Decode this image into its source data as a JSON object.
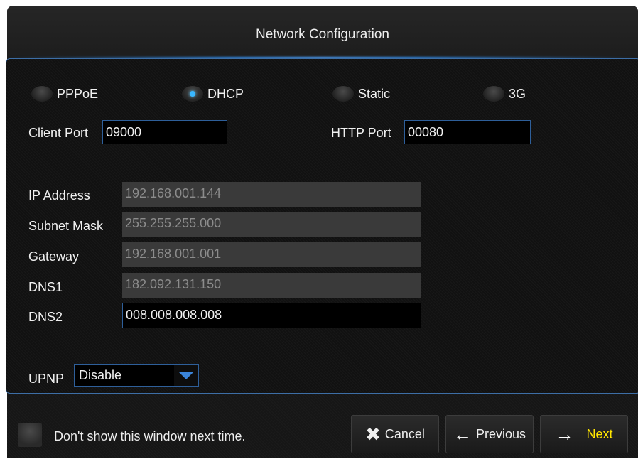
{
  "window": {
    "title": "Network Configuration"
  },
  "connection_types": [
    {
      "label": "PPPoE",
      "selected": false
    },
    {
      "label": "DHCP",
      "selected": true
    },
    {
      "label": "Static",
      "selected": false
    },
    {
      "label": "3G",
      "selected": false
    }
  ],
  "ports": {
    "client_label": "Client Port",
    "client_value": "09000",
    "http_label": "HTTP Port",
    "http_value": "00080"
  },
  "network": {
    "ip_label": "IP Address",
    "ip_value": "192.168.001.144",
    "mask_label": "Subnet Mask",
    "mask_value": "255.255.255.000",
    "gateway_label": "Gateway",
    "gateway_value": "192.168.001.001",
    "dns1_label": "DNS1",
    "dns1_value": "182.092.131.150",
    "dns2_label": "DNS2",
    "dns2_value": "008.008.008.008"
  },
  "upnp": {
    "label": "UPNP",
    "value": "Disable"
  },
  "footer": {
    "dont_show_label": "Don't show this window next time.",
    "cancel_label": "Cancel",
    "previous_label": "Previous",
    "next_label": "Next",
    "cancel_icon": "close-icon",
    "previous_icon": "arrow-left-icon",
    "next_icon": "arrow-right-icon"
  },
  "colors": {
    "accent": "#2f86e0",
    "next_text": "#ffe600",
    "radio_selected": "#39b7ff"
  }
}
